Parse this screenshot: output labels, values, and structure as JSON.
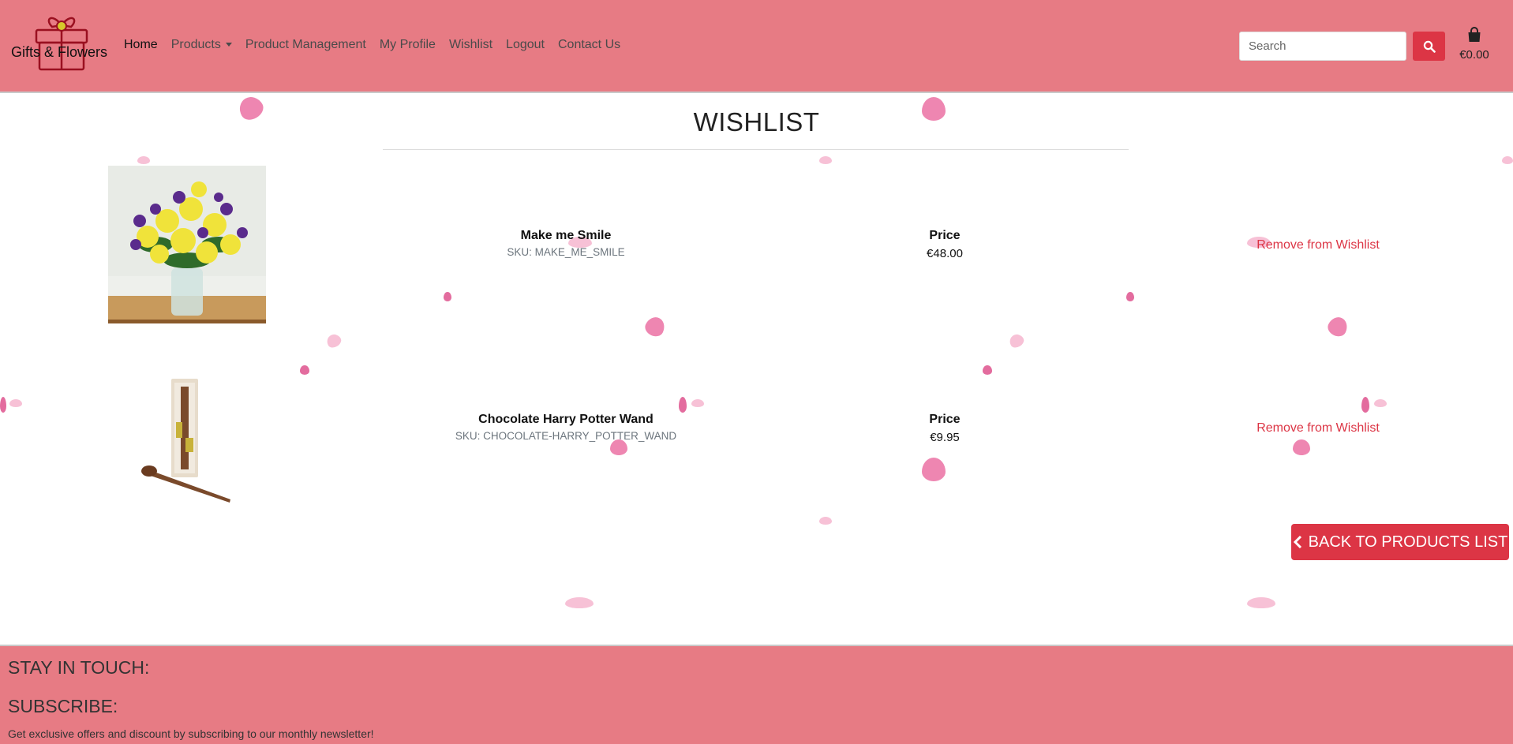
{
  "header": {
    "brand": "Gifts & Flowers",
    "nav": [
      {
        "label": "Home",
        "active": true
      },
      {
        "label": "Products",
        "dropdown": true
      },
      {
        "label": "Product Management"
      },
      {
        "label": "My Profile"
      },
      {
        "label": "Wishlist"
      },
      {
        "label": "Logout"
      },
      {
        "label": "Contact Us"
      }
    ],
    "search_placeholder": "Search",
    "cart_amount": "€0.00"
  },
  "main": {
    "title": "WISHLIST",
    "items": [
      {
        "name": "Make me Smile",
        "sku": "SKU: MAKE_ME_SMILE",
        "price_label": "Price",
        "price": "€48.00",
        "remove_label": "Remove from Wishlist",
        "image": "bouquet of yellow and purple flowers in glass vase"
      },
      {
        "name": "Chocolate Harry Potter Wand",
        "sku": "SKU: CHOCOLATE-HARRY_POTTER_WAND",
        "price_label": "Price",
        "price": "€9.95",
        "remove_label": "Remove from Wishlist",
        "image": "chocolate wand with its box"
      }
    ],
    "back_button": "BACK TO PRODUCTS LIST"
  },
  "footer": {
    "stay_in_touch": "STAY IN TOUCH:",
    "subscribe": "SUBSCRIBE:",
    "newsletter_text": "Get exclusive offers and discount by subscribing to our monthly newsletter!"
  },
  "colors": {
    "header_bg": "#e77b84",
    "accent": "#dc3545",
    "petal": "#ec79a8"
  },
  "icons": [
    "gift-logo-icon",
    "search-icon",
    "shopping-bag-icon",
    "chevron-left-icon",
    "caret-down-icon"
  ]
}
